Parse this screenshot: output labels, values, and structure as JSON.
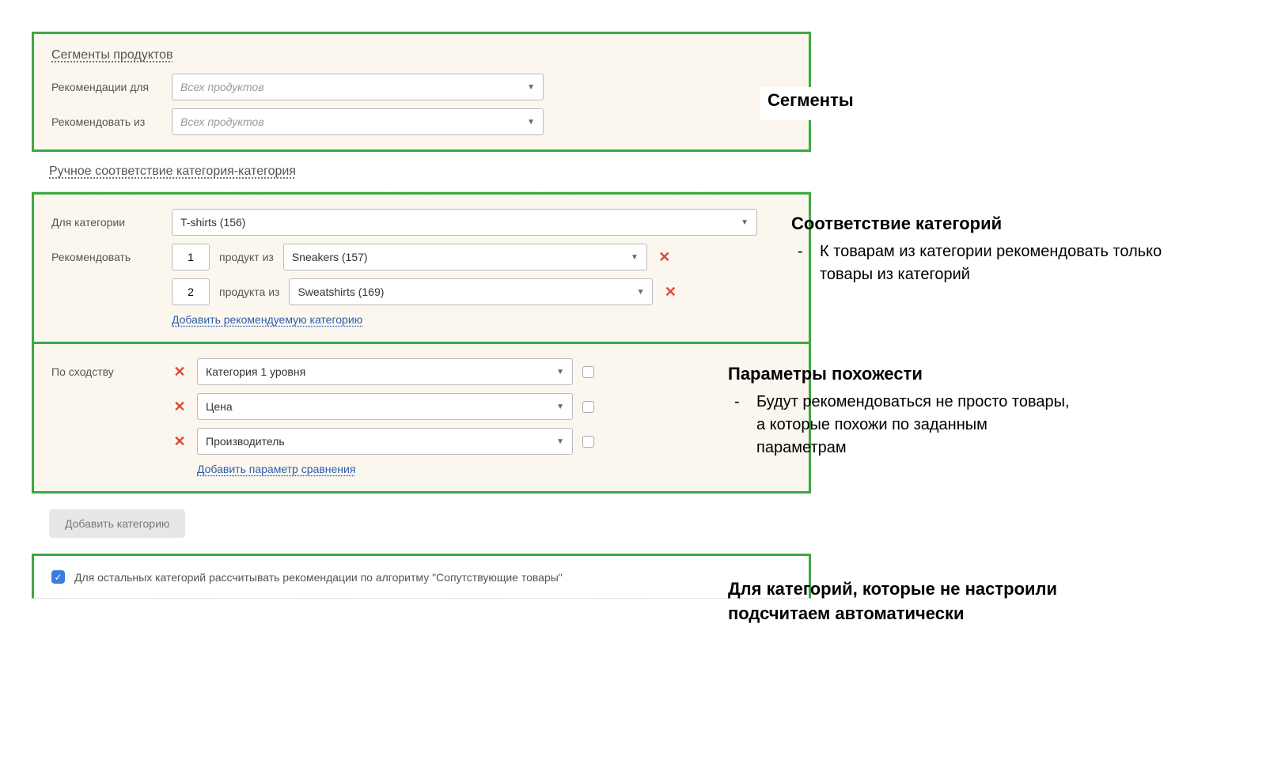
{
  "segments": {
    "title": "Сегменты продуктов",
    "rec_for_label": "Рекомендации для",
    "rec_for_value": "Всех продуктов",
    "rec_from_label": "Рекомендовать из",
    "rec_from_value": "Всех продуктов"
  },
  "manual_match": {
    "title": "Ручное соответствие категория-категория"
  },
  "category_block": {
    "for_category_label": "Для категории",
    "for_category_value": "T-shirts (156)",
    "recommend_label": "Рекомендовать",
    "rows": [
      {
        "count": "1",
        "unit_label": "продукт из",
        "category": "Sneakers (157)"
      },
      {
        "count": "2",
        "unit_label": "продукта из",
        "category": "Sweatshirts (169)"
      }
    ],
    "add_category_link": "Добавить рекомендуемую категорию"
  },
  "similarity_block": {
    "label": "По сходству",
    "rows": [
      {
        "value": "Категория 1 уровня"
      },
      {
        "value": "Цена"
      },
      {
        "value": "Производитель"
      }
    ],
    "add_param_link": "Добавить параметр сравнения"
  },
  "add_category_button": "Добавить категорию",
  "footer": {
    "checked": true,
    "text": "Для остальных категорий рассчитывать рекомендации по алгоритму \"Сопутствующие товары\""
  },
  "annotations": {
    "a1_title": "Сегменты",
    "a2_title": "Соответствие категорий",
    "a2_bullet": "К товарам из категории рекомендовать только товары из категорий",
    "a3_title": "Параметры похожести",
    "a3_bullet": "Будут рекомендоваться не просто товары, а которые похожи по заданным параметрам",
    "a4_text": "Для категорий, которые не настроили подсчитаем автоматически"
  }
}
